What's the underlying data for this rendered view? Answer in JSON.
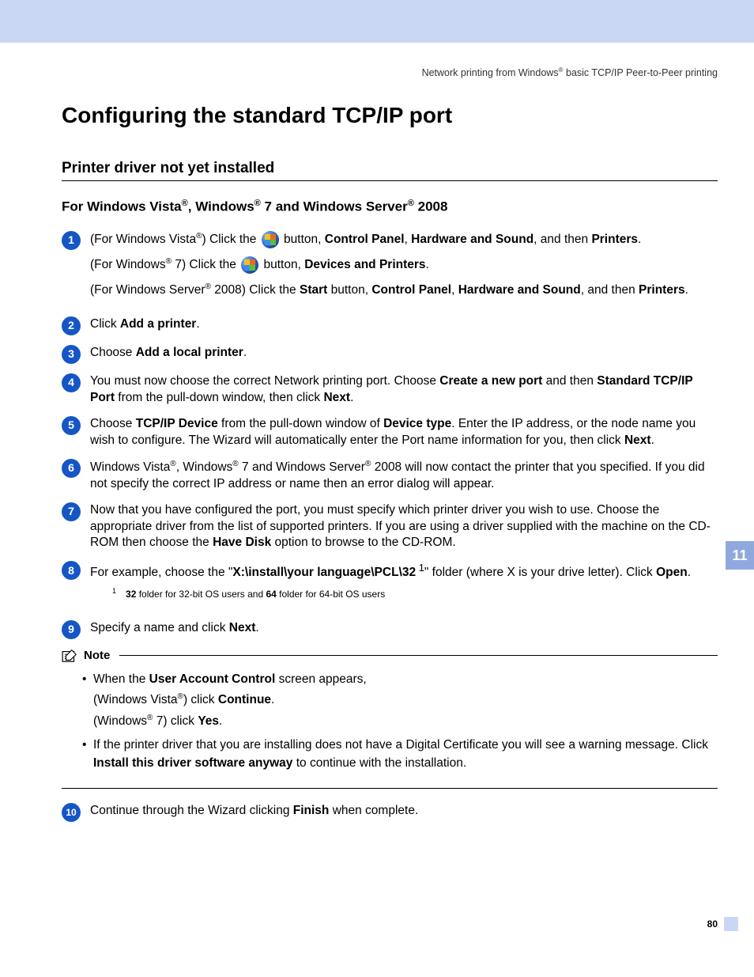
{
  "header": {
    "breadcrumb_pre": "Network printing from Windows",
    "breadcrumb_post": " basic TCP/IP Peer-to-Peer printing"
  },
  "tab": "11",
  "page_number": "80",
  "h1": "Configuring the standard TCP/IP port",
  "h2": "Printer driver not yet installed",
  "h3": {
    "p1": "For Windows Vista",
    "p2": ", Windows",
    "p3": " 7 and Windows Server",
    "p4": " 2008"
  },
  "steps": {
    "s1": {
      "a_pre": "(For Windows Vista",
      "a_mid": ") Click the ",
      "a_post": " button, ",
      "a_b1": "Control Panel",
      "a_c1": ", ",
      "a_b2": "Hardware and Sound",
      "a_c2": ", and then ",
      "a_b3": "Printers",
      "a_c3": ".",
      "b_pre": "(For Windows",
      "b_mid": " 7)  Click the ",
      "b_post": " button, ",
      "b_b1": "Devices and Printers",
      "b_c1": ".",
      "c_pre": "(For Windows Server",
      "c_mid": " 2008) Click the ",
      "c_b0": "Start",
      "c_c0": " button, ",
      "c_b1": "Control Panel",
      "c_c1": ", ",
      "c_b2": "Hardware and Sound",
      "c_c2": ", and then ",
      "c_b3": "Printers",
      "c_c3": "."
    },
    "s2": {
      "t1": "Click ",
      "b1": "Add a printer",
      "t2": "."
    },
    "s3": {
      "t1": "Choose ",
      "b1": "Add a local printer",
      "t2": "."
    },
    "s4": {
      "t1": "You must now choose the correct Network printing port. Choose ",
      "b1": "Create a new port",
      "t2": " and then ",
      "b2": "Standard TCP/IP Port",
      "t3": " from the pull-down window, then click ",
      "b3": "Next",
      "t4": "."
    },
    "s5": {
      "t1": "Choose ",
      "b1": "TCP/IP Device",
      "t2": " from the pull-down window of ",
      "b2": "Device type",
      "t3": ". Enter the IP address, or the node name you wish to configure. The Wizard will automatically enter the Port name information for you, then click ",
      "b3": "Next",
      "t4": "."
    },
    "s6": {
      "t1": "Windows Vista",
      "t2": ", Windows",
      "t3": " 7 and Windows Server",
      "t4": " 2008 will now contact the printer that you specified. If you did not specify the correct IP address or name then an error dialog will appear."
    },
    "s7": {
      "t1": "Now that you have configured the port, you must specify which printer driver you wish to use. Choose the appropriate driver from the list of supported printers. If you are using a driver supplied with the machine on the CD-ROM then choose the ",
      "b1": "Have Disk",
      "t2": " option to browse to the CD-ROM."
    },
    "s8": {
      "t1": "For example, choose the \"",
      "b1": "X:\\install\\your language\\PCL\\32",
      "sup": " 1",
      "t2": "\" folder (where X is your drive letter). Click ",
      "b2": "Open",
      "t3": "."
    },
    "footnote": {
      "num": "1",
      "b1": "32",
      "t1": " folder for 32-bit OS users and ",
      "b2": "64",
      "t2": " folder for 64-bit OS users"
    },
    "s9": {
      "t1": "Specify a name and click ",
      "b1": "Next",
      "t2": "."
    },
    "s10": {
      "t1": "Continue through the Wizard clicking ",
      "b1": "Finish",
      "t2": " when complete."
    }
  },
  "note": {
    "label": "Note",
    "li1": {
      "t1": "When the ",
      "b1": "User Account Control",
      "t2": " screen appears,",
      "l2a": "(Windows Vista",
      "l2b": ") click ",
      "l2c": "Continue",
      "l2d": ".",
      "l3a": "(Windows",
      "l3b": " 7) click ",
      "l3c": "Yes",
      "l3d": "."
    },
    "li2": {
      "t1": "If the printer driver that you are installing does not have a Digital Certificate you will see a warning message. Click ",
      "b1": "Install this driver software anyway",
      "t2": " to continue with the installation."
    }
  }
}
